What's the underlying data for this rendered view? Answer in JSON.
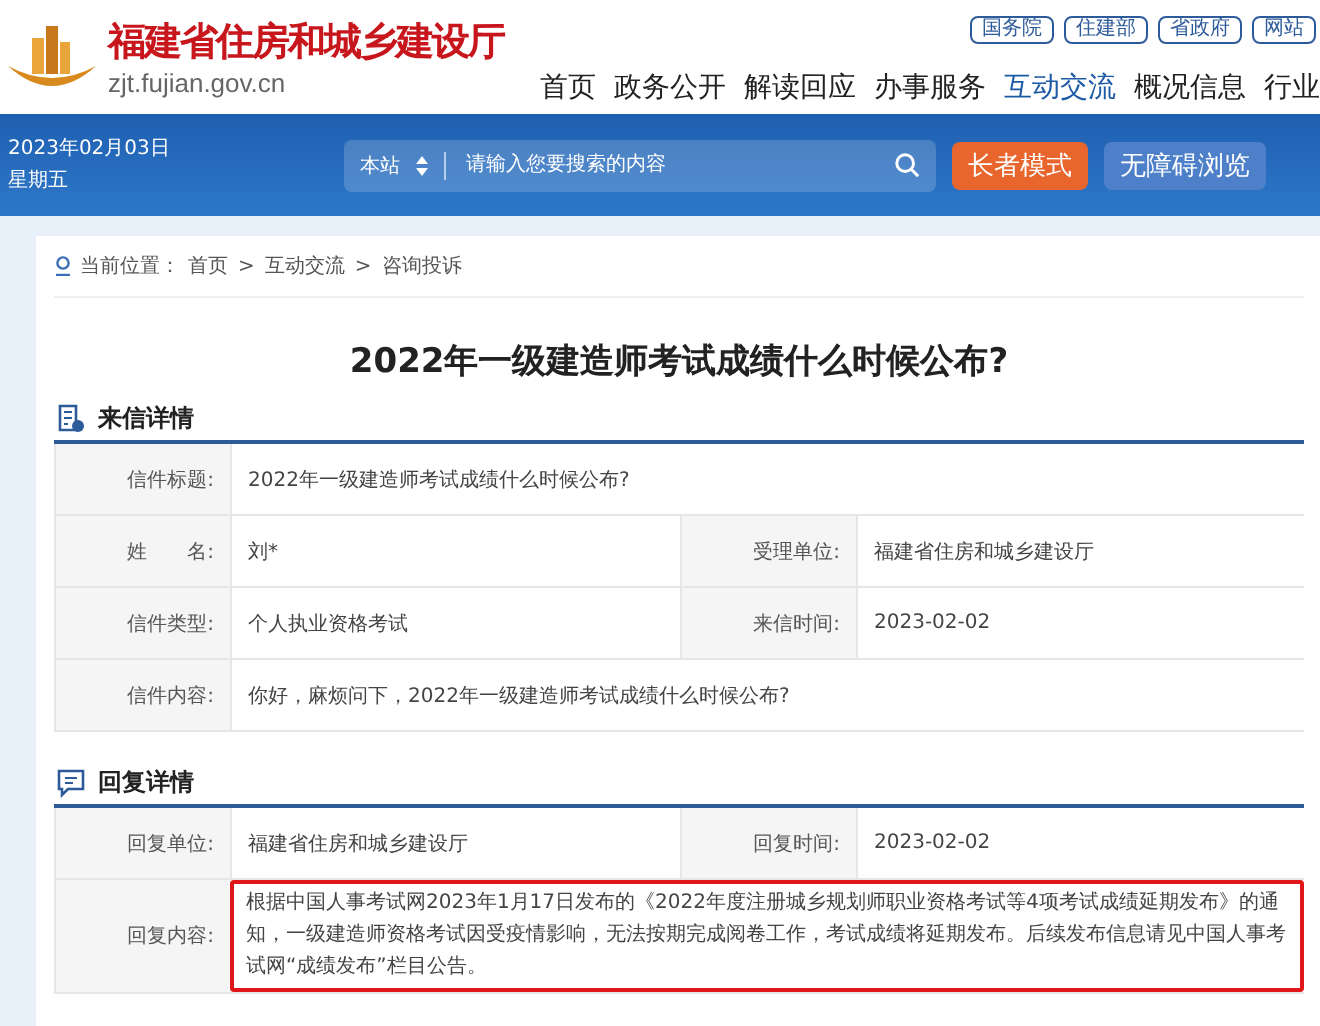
{
  "header": {
    "site_name": "福建省住房和城乡建设厅",
    "domain": "zjt.fujian.gov.cn",
    "top_links": [
      "国务院",
      "住建部",
      "省政府",
      "网站"
    ],
    "nav": [
      {
        "label": "首页",
        "selected": false
      },
      {
        "label": "政务公开",
        "selected": false
      },
      {
        "label": "解读回应",
        "selected": false
      },
      {
        "label": "办事服务",
        "selected": false
      },
      {
        "label": "互动交流",
        "selected": true
      },
      {
        "label": "概况信息",
        "selected": false
      },
      {
        "label": "行业",
        "selected": false
      }
    ]
  },
  "band": {
    "date": "2023年02月03日",
    "weekday": "星期五",
    "search_scope": "本站",
    "search_placeholder": "请输入您要搜索的内容",
    "buttons": [
      "长者模式",
      "无障碍浏览"
    ]
  },
  "breadcrumb": {
    "label": "当前位置：",
    "separator": ">",
    "items": [
      "首页",
      "互动交流",
      "咨询投诉"
    ]
  },
  "title": "2022年一级建造师考试成绩什么时候公布?",
  "sections": [
    {
      "kind": "letter",
      "heading": "来信详情",
      "rows": [
        {
          "highlighted": false,
          "fields": [
            {
              "label": "信件标题:",
              "value": "2022年一级建造师考试成绩什么时候公布?"
            }
          ]
        },
        {
          "highlighted": false,
          "fields": [
            {
              "label": "姓　　名:",
              "value": "刘*"
            },
            {
              "label": "受理单位:",
              "value": "福建省住房和城乡建设厅"
            }
          ]
        },
        {
          "highlighted": false,
          "fields": [
            {
              "label": "信件类型:",
              "value": "个人执业资格考试"
            },
            {
              "label": "来信时间:",
              "value": "2023-02-02"
            }
          ]
        },
        {
          "highlighted": false,
          "fields": [
            {
              "label": "信件内容:",
              "value": "你好，麻烦问下，2022年一级建造师考试成绩什么时候公布?"
            }
          ]
        }
      ]
    },
    {
      "kind": "reply",
      "heading": "回复详情",
      "rows": [
        {
          "highlighted": false,
          "fields": [
            {
              "label": "回复单位:",
              "value": "福建省住房和城乡建设厅"
            },
            {
              "label": "回复时间:",
              "value": "2023-02-02"
            }
          ]
        },
        {
          "highlighted": true,
          "fields": [
            {
              "label": "回复内容:",
              "value": "根据中国人事考试网2023年1月17日发布的《2022年度注册城乡规划师职业资格考试等4项考试成绩延期发布》的通知，一级建造师资格考试因受疫情影响，无法按期完成阅卷工作，考试成绩将延期发布。后续发布信息请见中国人事考试网“成绩发布”栏目公告。"
            }
          ]
        }
      ]
    }
  ]
}
